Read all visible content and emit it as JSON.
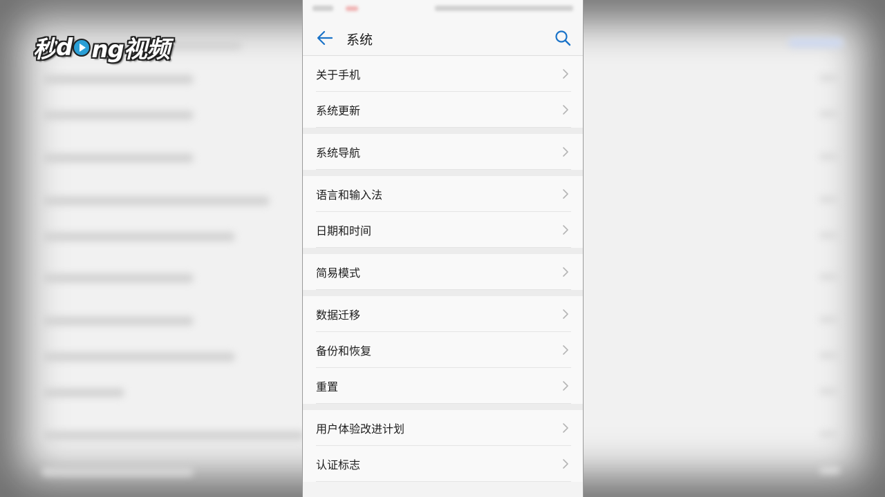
{
  "watermark": {
    "part1": "秒",
    "part2": "d",
    "part3": "ng视频"
  },
  "header": {
    "title": "系统",
    "back_icon": "arrow-left-icon",
    "search_icon": "search-icon"
  },
  "colors": {
    "accent": "#1a73c8",
    "chevron": "#b5b5b5"
  },
  "groups": [
    {
      "items": [
        {
          "label": "关于手机"
        },
        {
          "label": "系统更新"
        }
      ]
    },
    {
      "items": [
        {
          "label": "系统导航"
        }
      ]
    },
    {
      "items": [
        {
          "label": "语言和输入法"
        },
        {
          "label": "日期和时间"
        }
      ]
    },
    {
      "items": [
        {
          "label": "简易模式"
        }
      ]
    },
    {
      "items": [
        {
          "label": "数据迁移"
        },
        {
          "label": "备份和恢复"
        },
        {
          "label": "重置"
        }
      ]
    },
    {
      "items": [
        {
          "label": "用户体验改进计划"
        },
        {
          "label": "认证标志"
        }
      ]
    }
  ]
}
